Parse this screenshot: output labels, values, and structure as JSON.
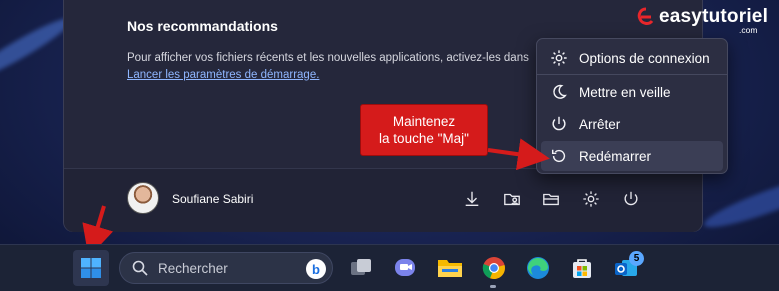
{
  "start_menu": {
    "section_title": "Nos recommandations",
    "recommendation_text": "Pour afficher vos fichiers récents et les nouvelles applications, activez-les dans",
    "settings_link": "Lancer les paramètres de démarrage.",
    "user_name": "Soufiane Sabiri",
    "footer_icons": [
      "download-icon",
      "folder-user-icon",
      "file-explorer-icon",
      "settings-gear-icon",
      "power-icon"
    ]
  },
  "power_menu": {
    "items": [
      {
        "label": "Options de connexion",
        "icon": "gear-icon"
      },
      {
        "label": "Mettre en veille",
        "icon": "moon-icon"
      },
      {
        "label": "Arrêter",
        "icon": "power-icon"
      },
      {
        "label": "Redémarrer",
        "icon": "restart-icon",
        "highlighted": true
      }
    ]
  },
  "callout": {
    "line1": "Maintenez",
    "line2": "la touche \"Maj\""
  },
  "taskbar": {
    "search_placeholder": "Rechercher",
    "bing_label": "b",
    "notification_count": "5",
    "apps": [
      "task-view",
      "teams-chat",
      "file-explorer",
      "chrome",
      "edge",
      "microsoft-store",
      "outlook"
    ]
  },
  "watermark": {
    "brand": "easytutoriel",
    "suffix": ".com"
  },
  "colors": {
    "callout_red": "#d51b1b",
    "menu_bg": "#2c2e42",
    "link": "#8fb6ff"
  }
}
